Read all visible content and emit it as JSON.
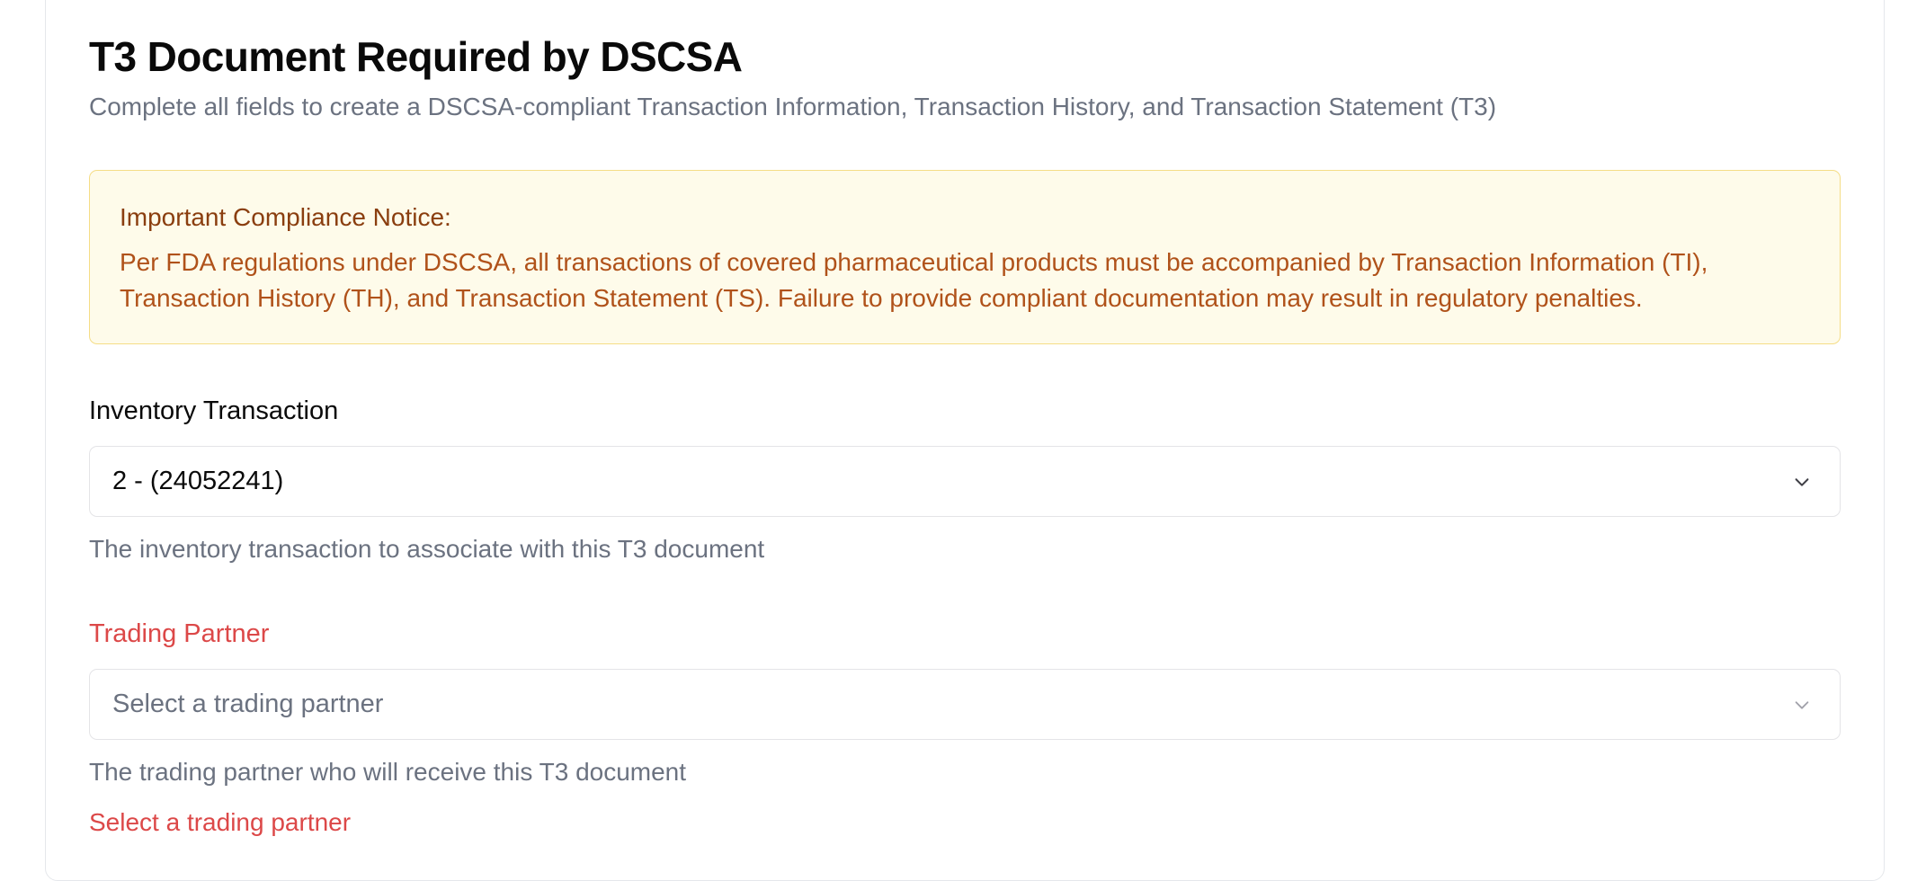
{
  "form": {
    "title": "T3 Document Required by DSCSA",
    "subtitle": "Complete all fields to create a DSCSA-compliant Transaction Information, Transaction History, and Transaction Statement (T3)"
  },
  "notice": {
    "title": "Important Compliance Notice:",
    "body": "Per FDA regulations under DSCSA, all transactions of covered pharmaceutical products must be accompanied by Transaction Information (TI), Transaction History (TH), and Transaction Statement (TS). Failure to provide compliant documentation may result in regulatory penalties."
  },
  "fields": {
    "inventory_transaction": {
      "label": "Inventory Transaction",
      "value": "2 - (24052241)",
      "help": "The inventory transaction to associate with this T3 document",
      "icon": "chevron-down-icon"
    },
    "trading_partner": {
      "label": "Trading Partner",
      "placeholder": "Select a trading partner",
      "help": "The trading partner who will receive this T3 document",
      "error": "Select a trading partner",
      "icon": "chevron-down-icon"
    }
  },
  "colors": {
    "error": "#dc4848",
    "notice_bg": "#fefbea",
    "notice_border": "#f5dd86",
    "notice_title": "#8a3e0f",
    "notice_text": "#b0521a",
    "muted_text": "#6b7280"
  }
}
